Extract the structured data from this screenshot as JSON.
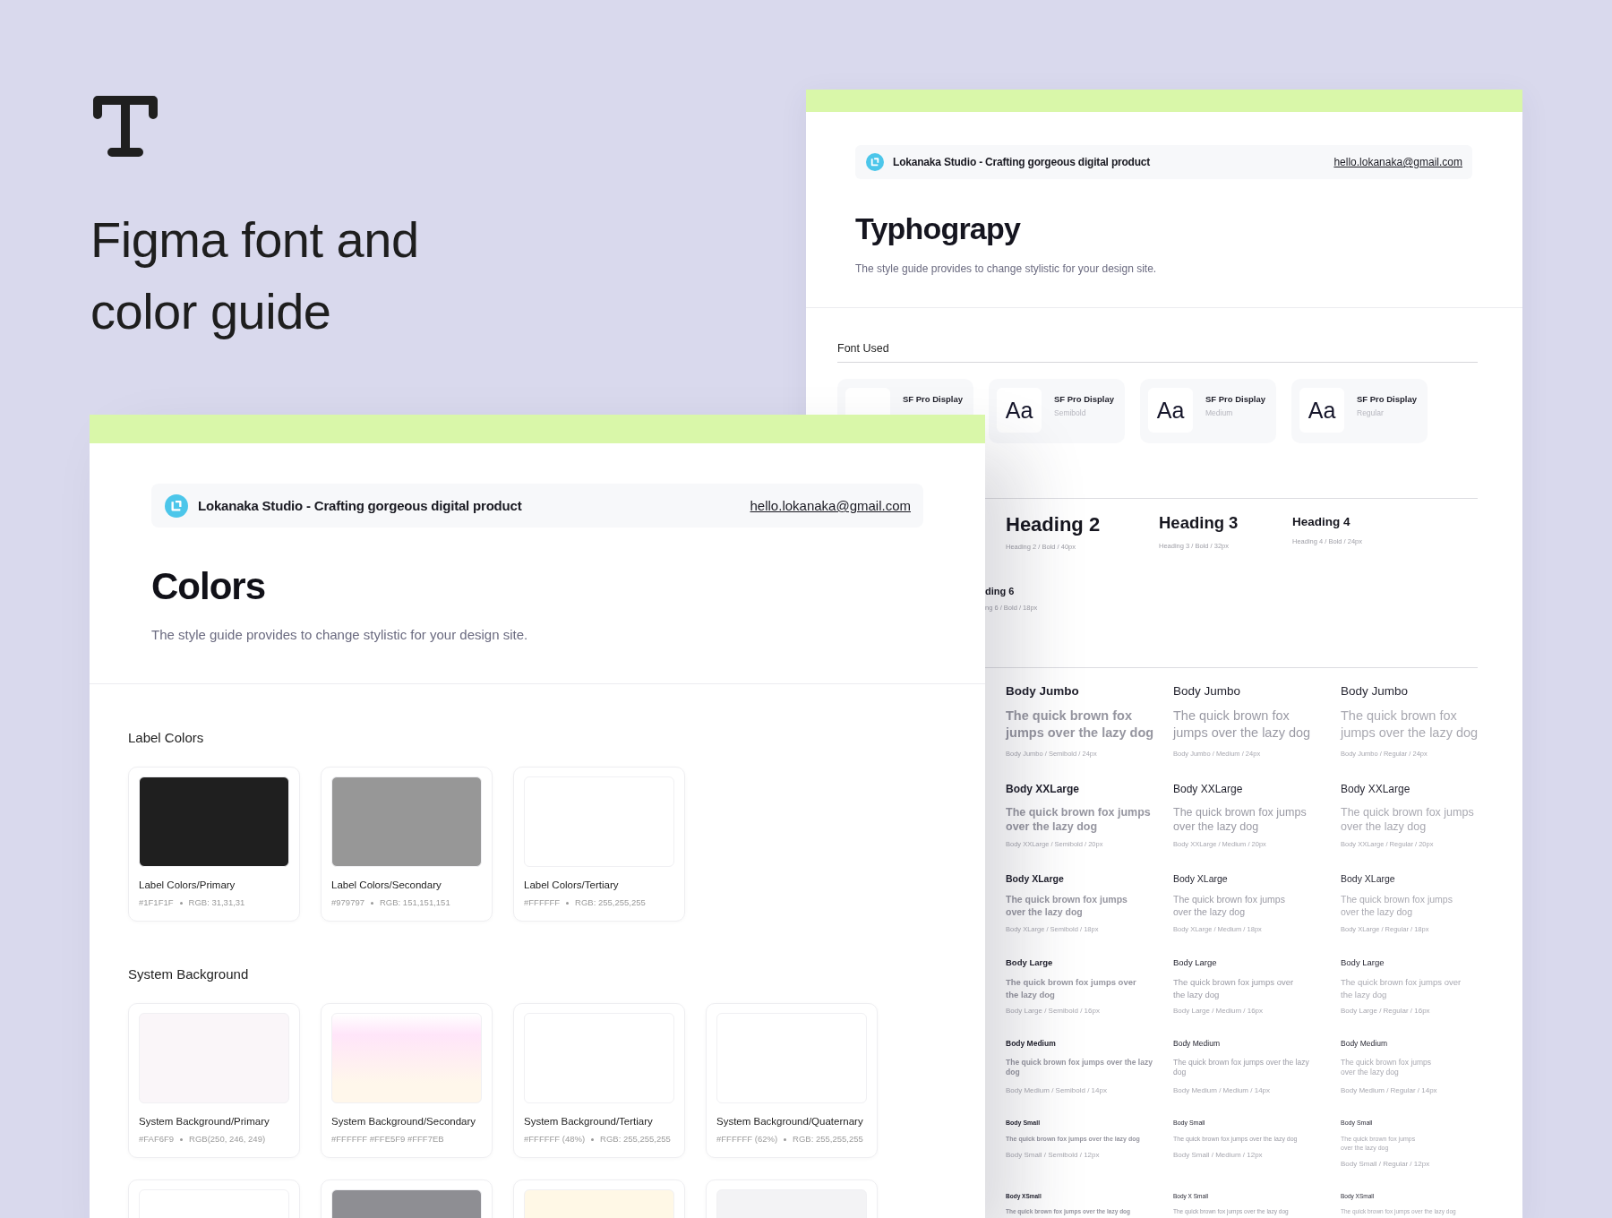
{
  "cover": {
    "title": "Figma font and color guide"
  },
  "typography_sheet": {
    "header": {
      "tagline": "Lokanaka Studio - Crafting gorgeous digital product",
      "email": "hello.lokanaka@gmail.com"
    },
    "title": "Typhograpy",
    "subtitle": "The style guide provides to change stylistic for your design site.",
    "font_used": {
      "label": "Font Used",
      "fonts": [
        {
          "family": "SF Pro Display"
        },
        {
          "sample": "Aa",
          "family": "SF Pro Display",
          "style": "Semibold"
        },
        {
          "sample": "Aa",
          "family": "SF Pro Display",
          "style": "Medium"
        },
        {
          "sample": "Aa",
          "family": "SF Pro Display",
          "style": "Regular"
        }
      ]
    },
    "headings": [
      {
        "kind": "h2",
        "name": "Heading 2",
        "caption": "Heading 2 / Bold / 40px"
      },
      {
        "kind": "h3",
        "name": "Heading 3",
        "caption": "Heading 3 / Bold / 32px"
      },
      {
        "kind": "h4",
        "name": "Heading 4",
        "caption": "Heading 4 / Bold / 24px"
      },
      {
        "kind": "h6",
        "name": "ding 6",
        "caption": "ng 6 / Bold / 18px"
      }
    ],
    "body_rows": [
      {
        "kind": "jumbo",
        "samples": [
          {
            "title": "Body Jumbo",
            "text": "The quick brown fox jumps over the lazy dog",
            "caption": "Body Jumbo / Semibold / 24px"
          },
          {
            "title": "Body Jumbo",
            "text": "The quick brown fox jumps over the lazy dog",
            "caption": "Body Jumbo / Medium / 24px"
          },
          {
            "title": "Body Jumbo",
            "text": "The quick brown fox jumps over the lazy dog",
            "caption": "Body Jumbo / Regular / 24px"
          }
        ]
      },
      {
        "kind": "xxlarge",
        "samples": [
          {
            "title": "Body XXLarge",
            "text": "The quick brown fox jumps over the lazy dog",
            "caption": "Body XXLarge / Semibold / 20px"
          },
          {
            "title": "Body XXLarge",
            "text": "The quick brown fox jumps over the lazy dog",
            "caption": "Body XXLarge / Medium / 20px"
          },
          {
            "title": "Body XXLarge",
            "text": "The quick brown fox jumps over the lazy dog",
            "caption": "Body XXLarge / Regular / 20px"
          }
        ]
      },
      {
        "kind": "xlarge",
        "samples": [
          {
            "title": "Body XLarge",
            "text": "The quick brown fox jumps over the lazy dog",
            "caption": "Body XLarge / Semibold / 18px"
          },
          {
            "title": "Body XLarge",
            "text": "The quick brown fox jumps over the lazy dog",
            "caption": "Body XLarge / Medium / 18px"
          },
          {
            "title": "Body XLarge",
            "text": "The quick brown fox jumps over the lazy dog",
            "caption": "Body XLarge / Regular / 18px"
          }
        ]
      },
      {
        "kind": "large",
        "samples": [
          {
            "title": "Body Large",
            "text": "The quick brown fox jumps over the lazy dog",
            "caption": "Body Large / Semibold / 16px"
          },
          {
            "title": "Body Large",
            "text": "The quick brown fox jumps over the lazy dog",
            "caption": "Body Large / Medium / 16px"
          },
          {
            "title": "Body Large",
            "text": "The quick brown fox jumps over the lazy dog",
            "caption": "Body Large / Regular / 16px"
          }
        ]
      },
      {
        "kind": "medium",
        "samples": [
          {
            "title": "Body Medium",
            "text": "The quick brown fox jumps over the lazy dog",
            "caption": "Body Medium / Semibold / 14px"
          },
          {
            "title": "Body Medium",
            "text": "The quick brown fox jumps over the lazy dog",
            "caption": "Body Medium / Medium / 14px"
          },
          {
            "title": "Body Medium",
            "text": "The quick brown fox jumps over the lazy dog",
            "caption": "Body Medium / Regular / 14px"
          }
        ]
      },
      {
        "kind": "small",
        "samples": [
          {
            "title": "Body Small",
            "text": "The quick brown fox jumps over the lazy dog",
            "caption": "Body Small / Semibold / 12px"
          },
          {
            "title": "Body Small",
            "text": "The quick brown fox jumps over the lazy dog",
            "caption": "Body Small / Medium / 12px"
          },
          {
            "title": "Body Small",
            "text": "The quick brown fox jumps over the lazy dog",
            "caption": "Body Small / Regular / 12px"
          }
        ]
      },
      {
        "kind": "xsmall",
        "samples": [
          {
            "title": "Body XSmall",
            "text": "The quick brown fox jumps over the lazy dog"
          },
          {
            "title": "Body X Small",
            "text": "The quick brown fox jumps over the lazy dog"
          },
          {
            "title": "Body XSmall",
            "text": "The quick brown fox jumps over the lazy dog"
          }
        ]
      }
    ]
  },
  "colors_sheet": {
    "header": {
      "tagline": "Lokanaka Studio - Crafting gorgeous digital product",
      "email": "hello.lokanaka@gmail.com"
    },
    "title": "Colors",
    "subtitle": "The style guide provides to change stylistic for your design site.",
    "groups": [
      {
        "label": "Label Colors",
        "swatches": [
          {
            "kind": "solid",
            "color": "#1f1f1f",
            "name": "Label Colors/Primary",
            "hex": "#1F1F1F",
            "rgb": "RGB: 31,31,31"
          },
          {
            "kind": "solid",
            "color": "#979797",
            "name": "Label Colors/Secondary",
            "hex": "#979797",
            "rgb": "RGB: 151,151,151"
          },
          {
            "kind": "solid",
            "color": "#ffffff",
            "name": "Label Colors/Tertiary",
            "hex": "#FFFFFF",
            "rgb": "RGB: 255,255,255"
          }
        ]
      },
      {
        "label": "System Background",
        "swatches": [
          {
            "kind": "solid",
            "color": "#faf6f9",
            "name": "System Background/Primary",
            "hex": "#FAF6F9",
            "rgb": "RGB(250, 246, 249)"
          },
          {
            "kind": "blend",
            "color": "#ffe5f9",
            "name": "System Background/Secondary",
            "hex": "#FFFFFF #FFE5F9 #FFF7EB"
          },
          {
            "kind": "solid",
            "color": "#ffffff",
            "name": "System Background/Tertiary",
            "hex": "#FFFFFF (48%)",
            "rgb": "RGB: 255,255,255"
          },
          {
            "kind": "solid",
            "color": "#ffffff",
            "name": "System Background/Quaternary",
            "hex": "#FFFFFF (62%)",
            "rgb": "RGB: 255,255,255"
          },
          {
            "kind": "solid",
            "color": "#ffffff"
          },
          {
            "kind": "solid",
            "color": "#8e8e93"
          },
          {
            "kind": "fade",
            "color": "#fff8e6"
          },
          {
            "kind": "fade",
            "color": "#f3f3f5"
          }
        ]
      }
    ]
  }
}
